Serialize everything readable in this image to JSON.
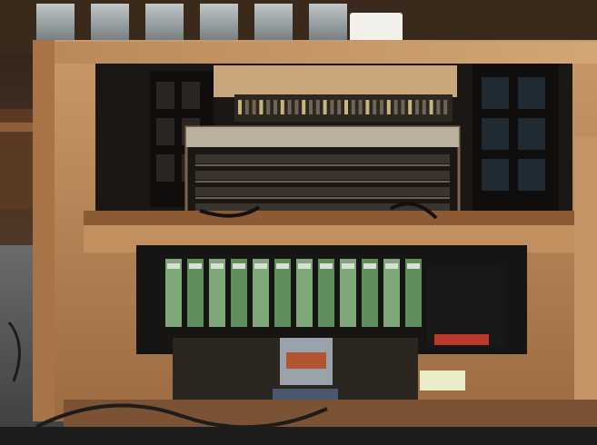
{
  "photo": {
    "subject": "",
    "palette": {
      "wood_light": "#c89a6a",
      "wood_mid": "#a9764a",
      "wood_dark": "#6e4a2e",
      "panel_black": "#121110",
      "circuit_green": "#5f8d5c",
      "circuit_dark": "#1f2a22",
      "floor": "#5e6063",
      "window_light": "#cfe0ea"
    },
    "regions": {
      "window_top": {
        "count": 6
      },
      "upper_rack": {
        "count": 4
      },
      "relay_boards": {
        "count": 12
      },
      "left_tray_pins": {
        "count": 6
      },
      "right_tray_pins": {
        "count": 6
      }
    }
  }
}
